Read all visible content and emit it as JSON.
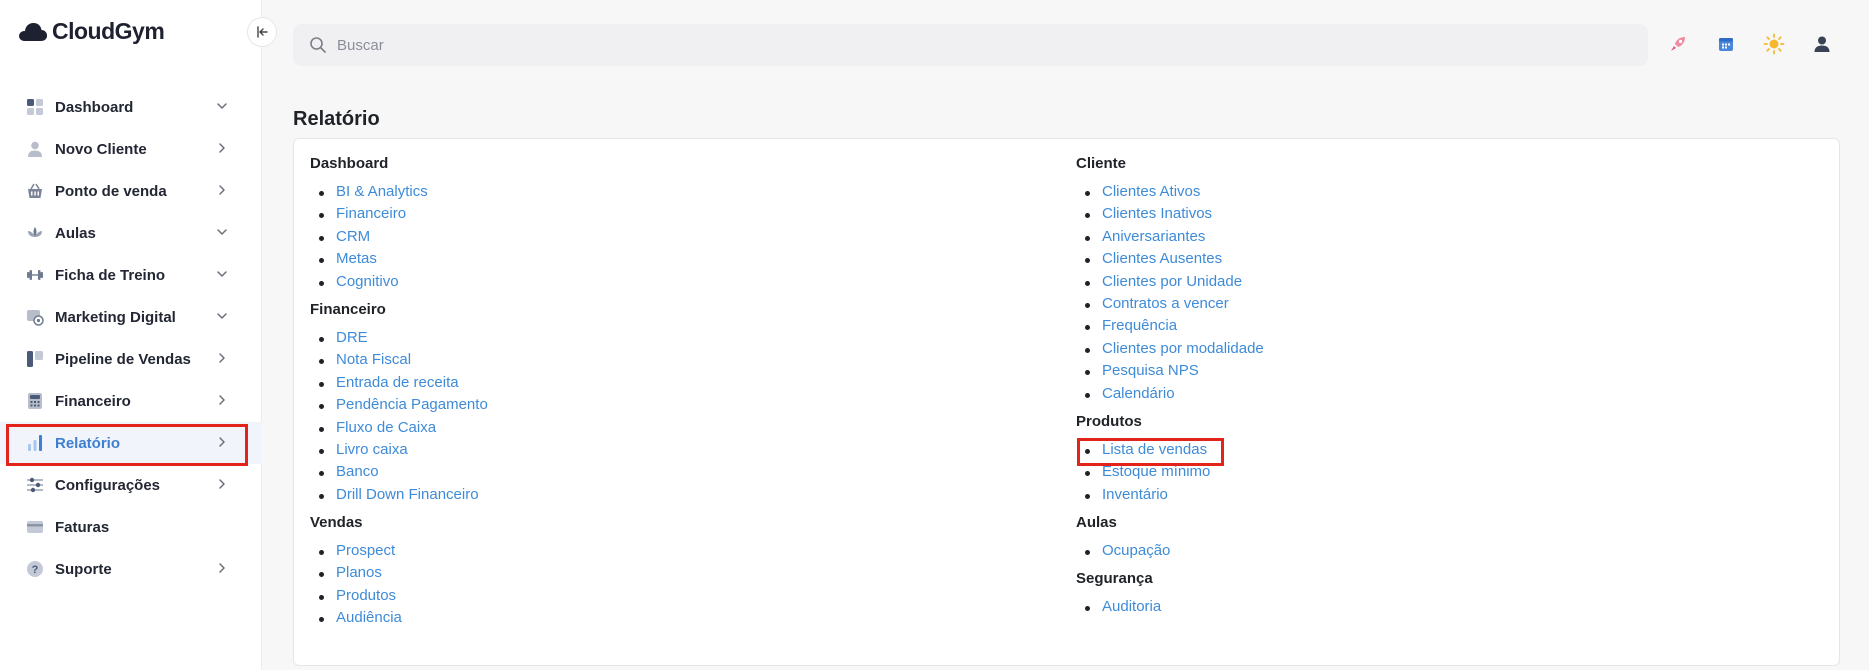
{
  "app": {
    "name": "CloudGym"
  },
  "sidebar": {
    "items": [
      {
        "label": "Dashboard",
        "icon": "dashboard-grid-icon",
        "chevron": "down"
      },
      {
        "label": "Novo Cliente",
        "icon": "user-icon",
        "chevron": "right"
      },
      {
        "label": "Ponto de venda",
        "icon": "basket-icon",
        "chevron": "right"
      },
      {
        "label": "Aulas",
        "icon": "lotus-icon",
        "chevron": "down"
      },
      {
        "label": "Ficha de Treino",
        "icon": "dumbbell-icon",
        "chevron": "down"
      },
      {
        "label": "Marketing Digital",
        "icon": "marketing-icon",
        "chevron": "down"
      },
      {
        "label": "Pipeline de Vendas",
        "icon": "pipeline-icon",
        "chevron": "right"
      },
      {
        "label": "Financeiro",
        "icon": "calculator-icon",
        "chevron": "right"
      },
      {
        "label": "Relatório",
        "icon": "bar-chart-icon",
        "chevron": "right",
        "active": true
      },
      {
        "label": "Configurações",
        "icon": "sliders-icon",
        "chevron": "right"
      },
      {
        "label": "Faturas",
        "icon": "credit-card-icon",
        "chevron": ""
      },
      {
        "label": "Suporte",
        "icon": "help-icon",
        "chevron": "right"
      }
    ]
  },
  "search": {
    "placeholder": "Buscar"
  },
  "topbar_icons": [
    "rocket-icon",
    "calendar-icon",
    "sun-icon",
    "account-icon"
  ],
  "page": {
    "title": "Relatório"
  },
  "report_columns": [
    [
      {
        "title": "Dashboard",
        "links": [
          "BI & Analytics",
          "Financeiro",
          "CRM",
          "Metas",
          "Cognitivo"
        ]
      },
      {
        "title": "Financeiro",
        "links": [
          "DRE",
          "Nota Fiscal",
          "Entrada de receita",
          "Pendência Pagamento",
          "Fluxo de Caixa",
          "Livro caixa",
          "Banco",
          "Drill Down Financeiro"
        ]
      },
      {
        "title": "Vendas",
        "links": [
          "Prospect",
          "Planos",
          "Produtos",
          "Audiência"
        ]
      }
    ],
    [
      {
        "title": "Cliente",
        "links": [
          "Clientes Ativos",
          "Clientes Inativos",
          "Aniversariantes",
          "Clientes Ausentes",
          "Clientes por Unidade",
          "Contratos a vencer",
          "Frequência",
          "Clientes por modalidade",
          "Pesquisa NPS",
          "Calendário"
        ]
      },
      {
        "title": "Produtos",
        "links": [
          "Lista de vendas",
          "Estoque mínimo",
          "Inventário"
        ]
      },
      {
        "title": "Aulas",
        "links": [
          "Ocupação"
        ]
      },
      {
        "title": "Segurança",
        "links": [
          "Auditoria"
        ]
      }
    ]
  ],
  "colors": {
    "accent": "#3e8bd8",
    "active_nav": "#3e7fd1",
    "highlight": "#e3241b"
  }
}
